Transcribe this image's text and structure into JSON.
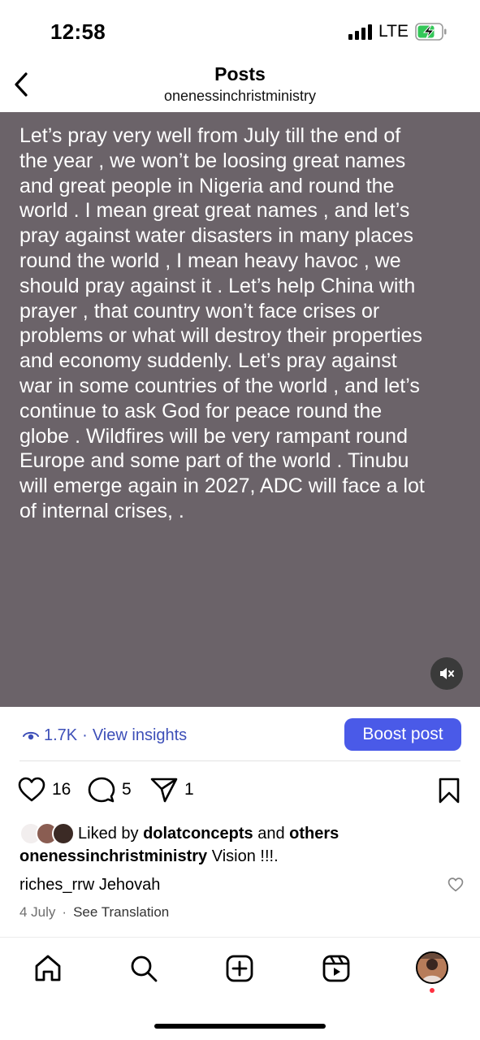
{
  "status_bar": {
    "time": "12:58",
    "network": "LTE",
    "icons": [
      "signal-icon",
      "battery-charging-icon"
    ]
  },
  "header": {
    "title": "Posts",
    "username": "onenessinchristministry",
    "back_icon": "chevron-left-icon"
  },
  "post": {
    "text": "Let’s pray very well from July till the end of\nthe year , we won’t be loosing great names\nand great people in Nigeria and round the\nworld .  I mean great great names , and let’s\npray against water disasters in many places\nround the world , I mean heavy havoc , we\nshould pray against it .  Let’s help China with\nprayer , that country won’t face crises or\nproblems or what will destroy their properties\nand economy suddenly.  Let’s pray against\nwar in some countries of the world , and let’s\ncontinue to ask God for peace round the\nglobe .  Wildfires will be very rampant round\nEurope and some part of the world .  Tinubu\nwill emerge again in 2027,  ADC will face a lot\nof internal crises, .",
    "background_color": "#6b6369",
    "mute_icon": "muted-speaker-icon"
  },
  "insights": {
    "views": "1.7K",
    "separator": "·",
    "link_label": "View insights",
    "boost_label": "Boost post",
    "accent_color": "#4a5ae8"
  },
  "actions": {
    "likes": "16",
    "comments": "5",
    "shares": "1"
  },
  "liked_by": {
    "prefix": "Liked by",
    "user": "dolatconcepts",
    "middle": "and",
    "suffix": "others"
  },
  "caption": {
    "username": "onenessinchristministry",
    "text": "Vision !!!."
  },
  "comment": {
    "username": "riches_rrw",
    "text": "Jehovah"
  },
  "meta": {
    "date": "4 July",
    "separator": "·",
    "translate_label": "See Translation"
  },
  "tab_bar": {
    "items": [
      "home-icon",
      "search-icon",
      "create-icon",
      "reels-icon",
      "profile-avatar"
    ]
  }
}
